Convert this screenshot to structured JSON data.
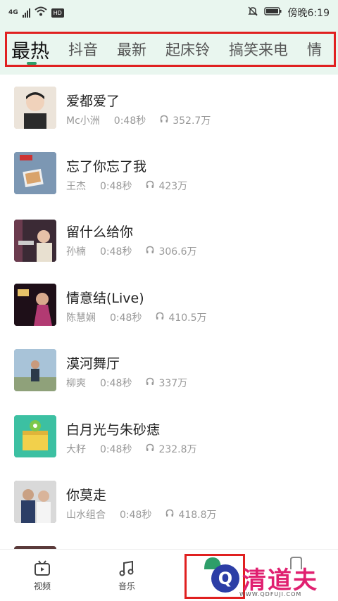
{
  "status_bar": {
    "network": "4G",
    "carrier_badge": "HD",
    "time": "傍晚6:19"
  },
  "tabs": [
    "最热",
    "抖音",
    "最新",
    "起床铃",
    "搞笑来电",
    "情"
  ],
  "songs": [
    {
      "title": "爱都爱了",
      "artist": "Mc小洲",
      "duration": "0:48秒",
      "plays": "352.7万",
      "thumb_color": "#d9c7b6"
    },
    {
      "title": "忘了你忘了我",
      "artist": "王杰",
      "duration": "0:48秒",
      "plays": "423万",
      "thumb_color": "#6d8aa8"
    },
    {
      "title": "留什么给你",
      "artist": "孙楠",
      "duration": "0:48秒",
      "plays": "306.6万",
      "thumb_color": "#4a3140"
    },
    {
      "title": "情意结(Live)",
      "artist": "陈慧娴",
      "duration": "0:48秒",
      "plays": "410.5万",
      "thumb_color": "#3a1e2a"
    },
    {
      "title": "漠河舞厅",
      "artist": "柳爽",
      "duration": "0:48秒",
      "plays": "337万",
      "thumb_color": "#9fb7c9"
    },
    {
      "title": "白月光与朱砂痣",
      "artist": "大籽",
      "duration": "0:48秒",
      "plays": "232.8万",
      "thumb_color": "#2fb59c"
    },
    {
      "title": "你莫走",
      "artist": "山水组合",
      "duration": "0:48秒",
      "plays": "418.8万",
      "thumb_color": "#8c8c8c"
    }
  ],
  "bottom_nav": {
    "video": "视频",
    "music": "音乐"
  },
  "watermark": {
    "text": "清道夫",
    "url": "WWW.QDFUJI.COM"
  },
  "colors": {
    "accent": "#2e9e6a",
    "highlight_box": "#e02020"
  }
}
